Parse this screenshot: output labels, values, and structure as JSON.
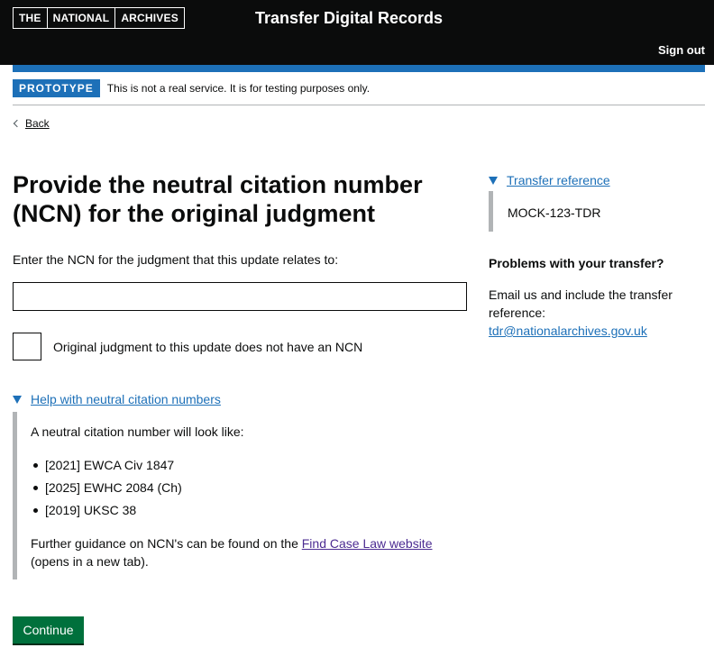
{
  "header": {
    "logo": [
      "THE",
      "NATIONAL",
      "ARCHIVES"
    ],
    "service_name": "Transfer Digital Records",
    "sign_out": "Sign out",
    "accent_color": "#1d70b8"
  },
  "phase_banner": {
    "tag": "PROTOTYPE",
    "text": "This is not a real service. It is for testing purposes only."
  },
  "back_link": "Back",
  "main": {
    "title": "Provide the neutral citation number (NCN) for the original judgment",
    "hint": "Enter the NCN for the judgment that this update relates to:",
    "ncn_input_value": "",
    "checkbox_label": "Original judgment to this update does not have an NCN",
    "checkbox_checked": false,
    "details": {
      "summary": "Help with neutral citation numbers",
      "intro": "A neutral citation number will look like:",
      "examples": [
        "[2021] EWCA Civ 1847",
        "[2025] EWHC 2084 (Ch)",
        "[2019] UKSC 38"
      ],
      "guidance_before": "Further guidance on NCN's can be found on the ",
      "guidance_link": "Find Case Law website",
      "guidance_after": "(opens in a new tab)."
    },
    "continue_button": "Continue"
  },
  "sidebar": {
    "transfer_reference_summary": "Transfer reference",
    "transfer_reference": "MOCK-123-TDR",
    "problems_heading": "Problems with your transfer?",
    "email_text": "Email us and include the transfer reference:",
    "email_link": "tdr@nationalarchives.gov.uk"
  },
  "icons": {
    "back": "chevron-left-icon",
    "details_open": "triangle-down-icon"
  }
}
